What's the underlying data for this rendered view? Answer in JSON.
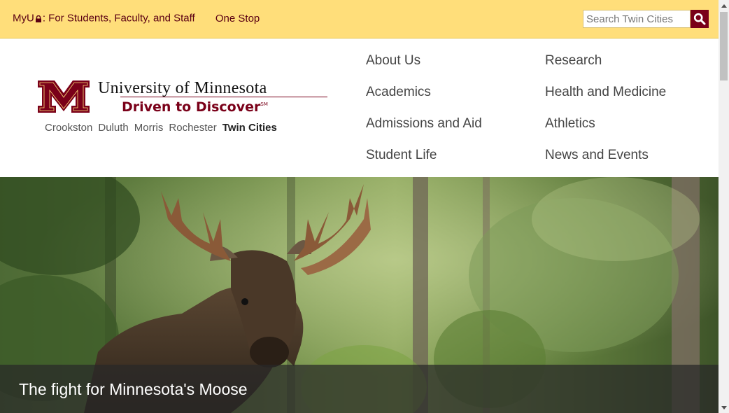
{
  "utility_bar": {
    "myu_label": "MyU",
    "myu_suffix": ": For Students, Faculty, and Staff",
    "one_stop": "One Stop",
    "search_placeholder": "Search Twin Cities"
  },
  "logo": {
    "name": "University of Minnesota",
    "tagline": "Driven to Discover",
    "trademark": "SM"
  },
  "campuses": {
    "items": [
      "Crookston",
      "Duluth",
      "Morris",
      "Rochester"
    ],
    "current": "Twin Cities"
  },
  "main_nav": {
    "col1": [
      "About Us",
      "Academics",
      "Admissions and Aid",
      "Student Life"
    ],
    "col2": [
      "Research",
      "Health and Medicine",
      "Athletics",
      "News and Events"
    ]
  },
  "hero": {
    "caption": "The fight for Minnesota's Moose"
  },
  "colors": {
    "gold": "#ffde7a",
    "maroon": "#7a0019"
  }
}
